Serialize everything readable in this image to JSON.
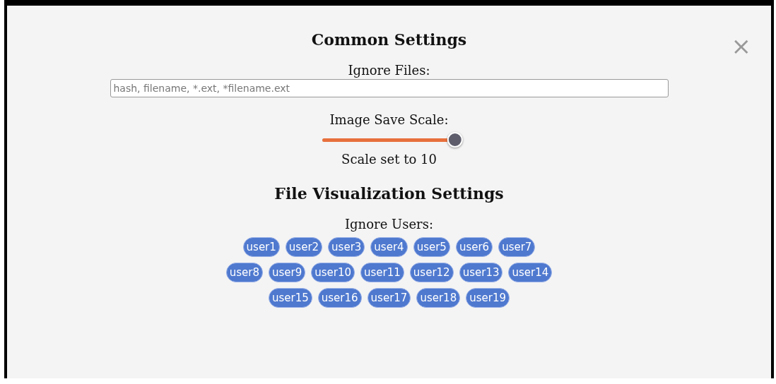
{
  "close": "×",
  "common": {
    "title": "Common Settings",
    "ignore_files": {
      "label": "Ignore Files:",
      "placeholder": "hash, filename, *.ext, *filename.ext"
    },
    "scale": {
      "label": "Image Save Scale:",
      "level": 1,
      "reading": "Scale set to 10"
    }
  },
  "visualization": {
    "title": "File Visualization Settings",
    "ignore_users": {
      "label": "Ignore Users:",
      "users": [
        {
          "label": "user1",
          "selected": false
        },
        {
          "label": "user2",
          "selected": false
        },
        {
          "label": "user3",
          "selected": false
        },
        {
          "label": "user4",
          "selected": false
        },
        {
          "label": "user5",
          "selected": false
        },
        {
          "label": "user6",
          "selected": false
        },
        {
          "label": "user7",
          "selected": false
        },
        {
          "label": "user8",
          "selected": false
        },
        {
          "label": "user9",
          "selected": false
        },
        {
          "label": "user10",
          "selected": false
        },
        {
          "label": "user11",
          "selected": false
        },
        {
          "label": "user12",
          "selected": false
        },
        {
          "label": "user13",
          "selected": false
        },
        {
          "label": "user14",
          "selected": false
        },
        {
          "label": "user15",
          "selected": false
        },
        {
          "label": "user16",
          "selected": false
        },
        {
          "label": "user17",
          "selected": false
        },
        {
          "label": "user18",
          "selected": false
        },
        {
          "label": "user19",
          "selected": false
        }
      ]
    }
  }
}
